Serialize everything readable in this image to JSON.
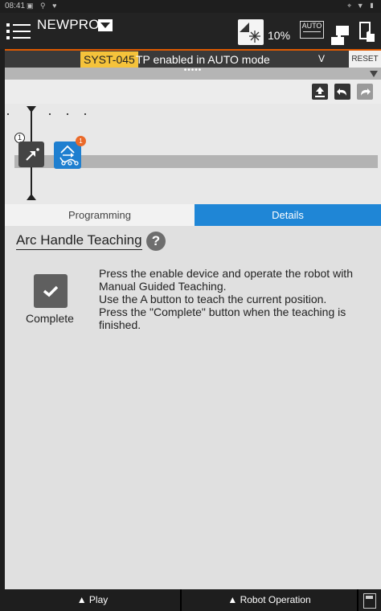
{
  "statusbar": {
    "time": "08:41",
    "left_icons": "▣ ⚲ ♥",
    "right_icons": "⌖ ▼ ▮"
  },
  "header": {
    "program_name": "NEWPROG",
    "speed": "10%",
    "auto_label": "AUTO"
  },
  "alarm": {
    "code": "SYST-045",
    "message": "TP enabled in AUTO mode",
    "expand": "V",
    "reset": "RESET"
  },
  "grip": {
    "dots": "•••••"
  },
  "timeline": {
    "step_number": "1",
    "badge_count": "1"
  },
  "tabs": {
    "programming": "Programming",
    "details": "Details"
  },
  "details": {
    "title": "Arc Handle Teaching",
    "help": "?",
    "complete_label": "Complete",
    "instructions": [
      "Press the enable device and operate the robot with Manual Guided Teaching.",
      "Use the A button to teach the current position.",
      "Press the \"Complete\" button when the teaching is finished."
    ]
  },
  "bottombar": {
    "play": "▲ Play",
    "robot_operation": "▲ Robot Operation"
  },
  "colors": {
    "accent": "#1f86d6",
    "alarm_code_bg": "#f5c33b",
    "alarm_line": "#e05a00",
    "badge": "#ea6a2a"
  }
}
